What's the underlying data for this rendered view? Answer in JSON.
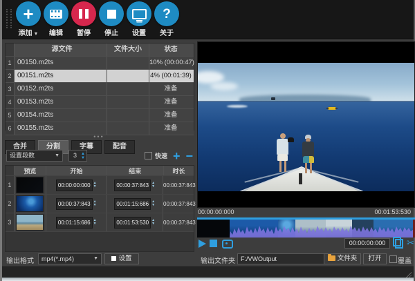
{
  "toolbar": {
    "items": [
      {
        "label": "添加",
        "icon": "plus",
        "dropdown": true
      },
      {
        "label": "编辑",
        "icon": "film"
      },
      {
        "label": "暂停",
        "icon": "pause"
      },
      {
        "label": "停止",
        "icon": "stop"
      },
      {
        "label": "设置",
        "icon": "monitor"
      },
      {
        "label": "关于",
        "icon": "question"
      }
    ],
    "accent_color": "#1e8bc3",
    "pause_color": "#d6274d"
  },
  "file_table": {
    "headers": {
      "source": "源文件",
      "size": "文件大小",
      "status": "状态"
    },
    "rows": [
      {
        "num": "1",
        "name": "00150.m2ts",
        "size": "",
        "status": "10% (00:00:47)"
      },
      {
        "num": "2",
        "name": "00151.m2ts",
        "size": "",
        "status": "4% (00:01:39)"
      },
      {
        "num": "3",
        "name": "00152.m2ts",
        "size": "",
        "status": "准备"
      },
      {
        "num": "4",
        "name": "00153.m2ts",
        "size": "",
        "status": "准备"
      },
      {
        "num": "5",
        "name": "00154.m2ts",
        "size": "",
        "status": "准备"
      },
      {
        "num": "6",
        "name": "00155.m2ts",
        "size": "",
        "status": "准备"
      }
    ],
    "selected_row_color": "#d2d2d2"
  },
  "tabs": [
    {
      "label": "合并"
    },
    {
      "label": "分割"
    },
    {
      "label": "字幕"
    },
    {
      "label": "配音"
    }
  ],
  "split_controls": {
    "segments_label": "设置段数",
    "segments_value": "3",
    "fast_label": "快速",
    "plus": "+",
    "minus": "−"
  },
  "split_table": {
    "headers": {
      "preview": "预览",
      "start": "开始",
      "end": "结束",
      "duration": "时长"
    },
    "rows": [
      {
        "num": "1",
        "start": "00:00:00:000",
        "end": "00:00:37:843",
        "duration": "00:00:37:843"
      },
      {
        "num": "2",
        "start": "00:00:37:843",
        "end": "00:01:15:686",
        "duration": "00:00:37:843"
      },
      {
        "num": "3",
        "start": "00:01:15:686",
        "end": "00:01:53:530",
        "duration": "00:00:37:843"
      }
    ]
  },
  "player": {
    "time_start": "00:00:00:000",
    "time_end": "00:01:53:530",
    "current_time": "00:00:00:000",
    "accent_color": "#2f9fe0",
    "waveform_color": "#8075e0"
  },
  "output": {
    "format_label": "输出格式",
    "format_value": "mp4(*.mp4)",
    "settings_label": "设置",
    "folder_label": "输出文件夹",
    "folder_value": "F:/VWOutput",
    "folder_button": "文件夹",
    "open_button": "打开",
    "overwrite_label": "覆盖",
    "folder_icon_color": "#e8a33d"
  }
}
